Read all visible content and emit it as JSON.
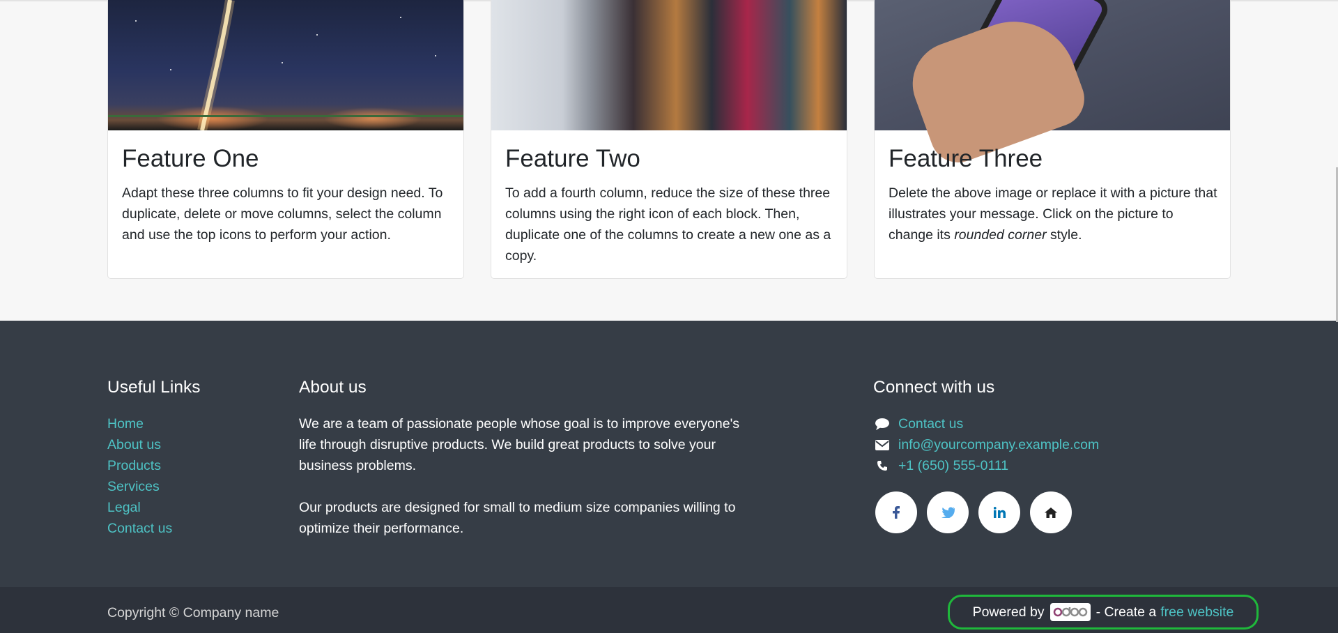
{
  "features": [
    {
      "title": "Feature One",
      "text": "Adapt these three columns to fit your design need. To duplicate, delete or move columns, select the column and use the top icons to perform your action.",
      "image": "rocket-launch-image"
    },
    {
      "title": "Feature Two",
      "text": "To add a fourth column, reduce the size of these three columns using the right icon of each block. Then, duplicate one of the columns to create a new one as a copy.",
      "image": "clothes-rack-image"
    },
    {
      "title": "Feature Three",
      "text_before": "Delete the above image or replace it with a picture that illustrates your message. Click on the picture to change its ",
      "text_em": "rounded corner",
      "text_after": " style.",
      "image": "phone-hand-image"
    }
  ],
  "footer": {
    "useful_links": {
      "title": "Useful Links",
      "items": [
        "Home",
        "About us",
        "Products",
        "Services",
        "Legal",
        "Contact us"
      ]
    },
    "about": {
      "title": "About us",
      "paragraphs": [
        "We are a team of passionate people whose goal is to improve everyone's life through disruptive products. We build great products to solve your business problems.",
        "Our products are designed for small to medium size companies willing to optimize their performance."
      ]
    },
    "connect": {
      "title": "Connect with us",
      "contact": "Contact us",
      "email": "info@yourcompany.example.com",
      "phone": "+1 (650) 555-0111",
      "social": [
        "facebook-icon",
        "twitter-icon",
        "linkedin-icon",
        "home-icon"
      ]
    }
  },
  "bottom": {
    "copyright": "Copyright © Company name",
    "powered_by": "Powered by",
    "logo_text": "odoo",
    "create_text": "- Create a",
    "free_website": "free website"
  },
  "colors": {
    "link": "#4ec3c5",
    "footer_bg": "#363d46",
    "bottom_bg": "#2d323b",
    "highlight": "#1fb83b"
  }
}
